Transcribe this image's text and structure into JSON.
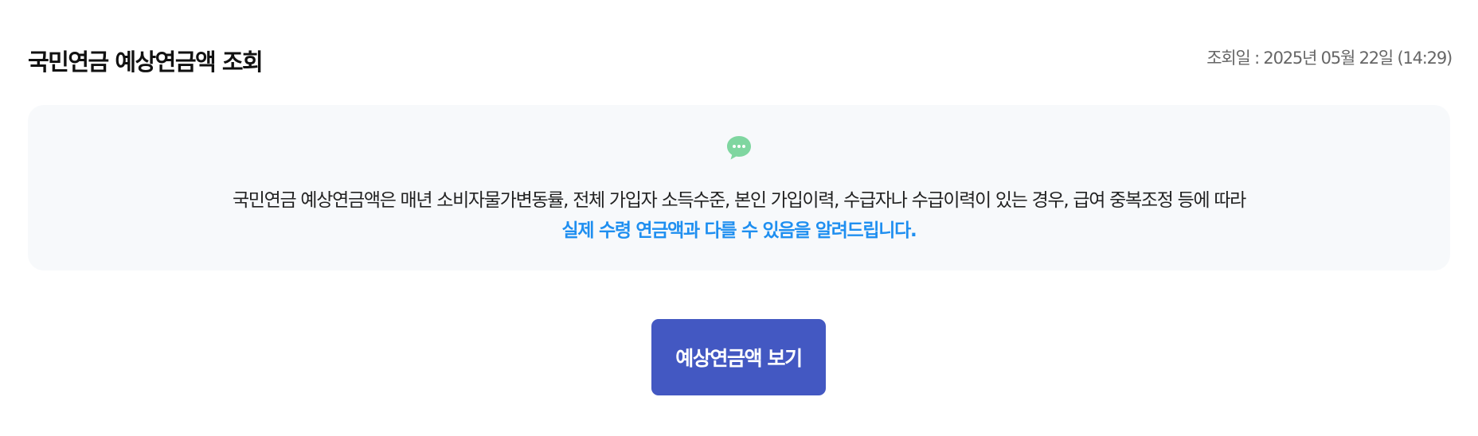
{
  "header": {
    "title": "국민연금 예상연금액 조회",
    "query_date": "조회일 : 2025년 05월 22일 (14:29)"
  },
  "notice": {
    "icon": "chat-bubble-icon",
    "icon_color": "#7fd6a0",
    "line1": "국민연금 예상연금액은 매년 소비자물가변동률, 전체 가입자 소득수준, 본인 가입이력, 수급자나 수급이력이 있는 경우, 급여 중복조정 등에 따라",
    "line2": "실제 수령 연금액과 다를 수 있음을 알려드립니다.",
    "highlight_color": "#1f8ff0",
    "background_color": "#f7f9fb"
  },
  "actions": {
    "view_label": "예상연금액 보기",
    "button_color": "#4358c2"
  }
}
